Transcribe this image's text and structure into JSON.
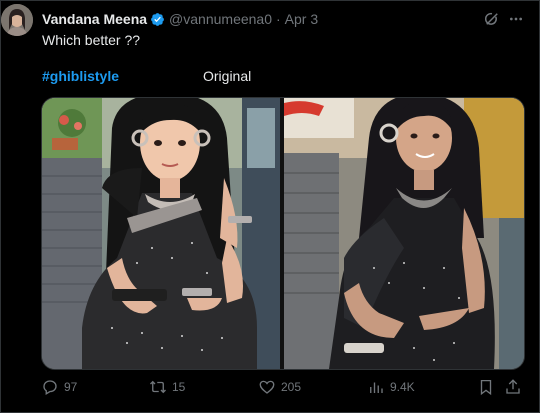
{
  "tweet": {
    "author_name": "Vandana Meena",
    "handle": "@vannumeena0",
    "separator": "·",
    "date": "Apr 3",
    "text": "Which better ??",
    "label_left": "#ghiblistyle",
    "label_right": "Original"
  },
  "actions": {
    "replies": "97",
    "reposts": "15",
    "likes": "205",
    "views": "9.4K"
  },
  "icons": {
    "verified": "verified-badge-icon",
    "grok": "grok-icon",
    "more": "more-icon",
    "reply": "reply-icon",
    "repost": "repost-icon",
    "like": "heart-icon",
    "views": "views-chart-icon",
    "bookmark": "bookmark-icon",
    "share": "share-icon"
  },
  "colors": {
    "background": "#000000",
    "text": "#e7e9ea",
    "muted": "#71767b",
    "accent": "#1d9bf0"
  }
}
